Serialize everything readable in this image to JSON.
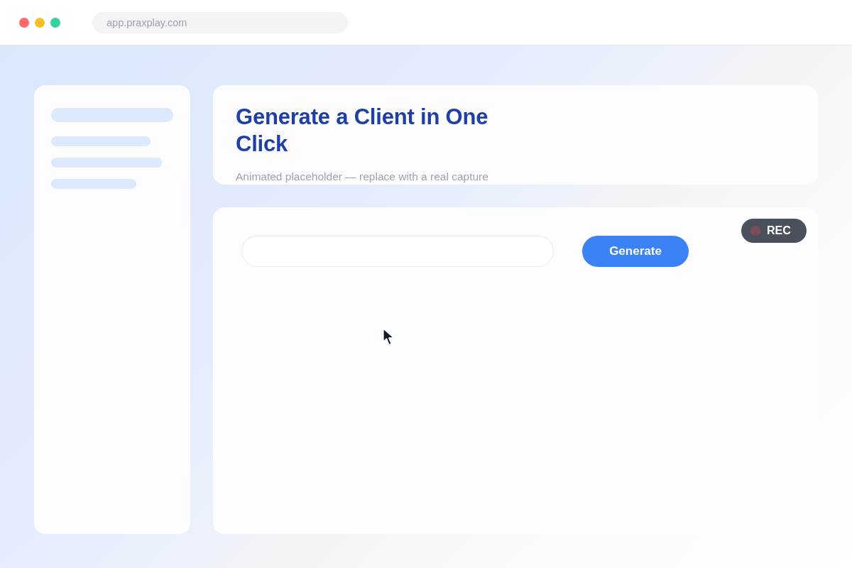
{
  "window": {
    "controls": [
      {
        "color": "#ff6b6b"
      },
      {
        "color": "#fbbf24"
      },
      {
        "color": "#34d399"
      }
    ]
  },
  "address_bar": {
    "url": "app.praxplay.com"
  },
  "header": {
    "title": "Generate a Client in One Click",
    "subtitle": "Animated placeholder — replace with a real capture"
  },
  "demo": {
    "button": "Generate",
    "recording_badge": {
      "label": "REC"
    }
  }
}
